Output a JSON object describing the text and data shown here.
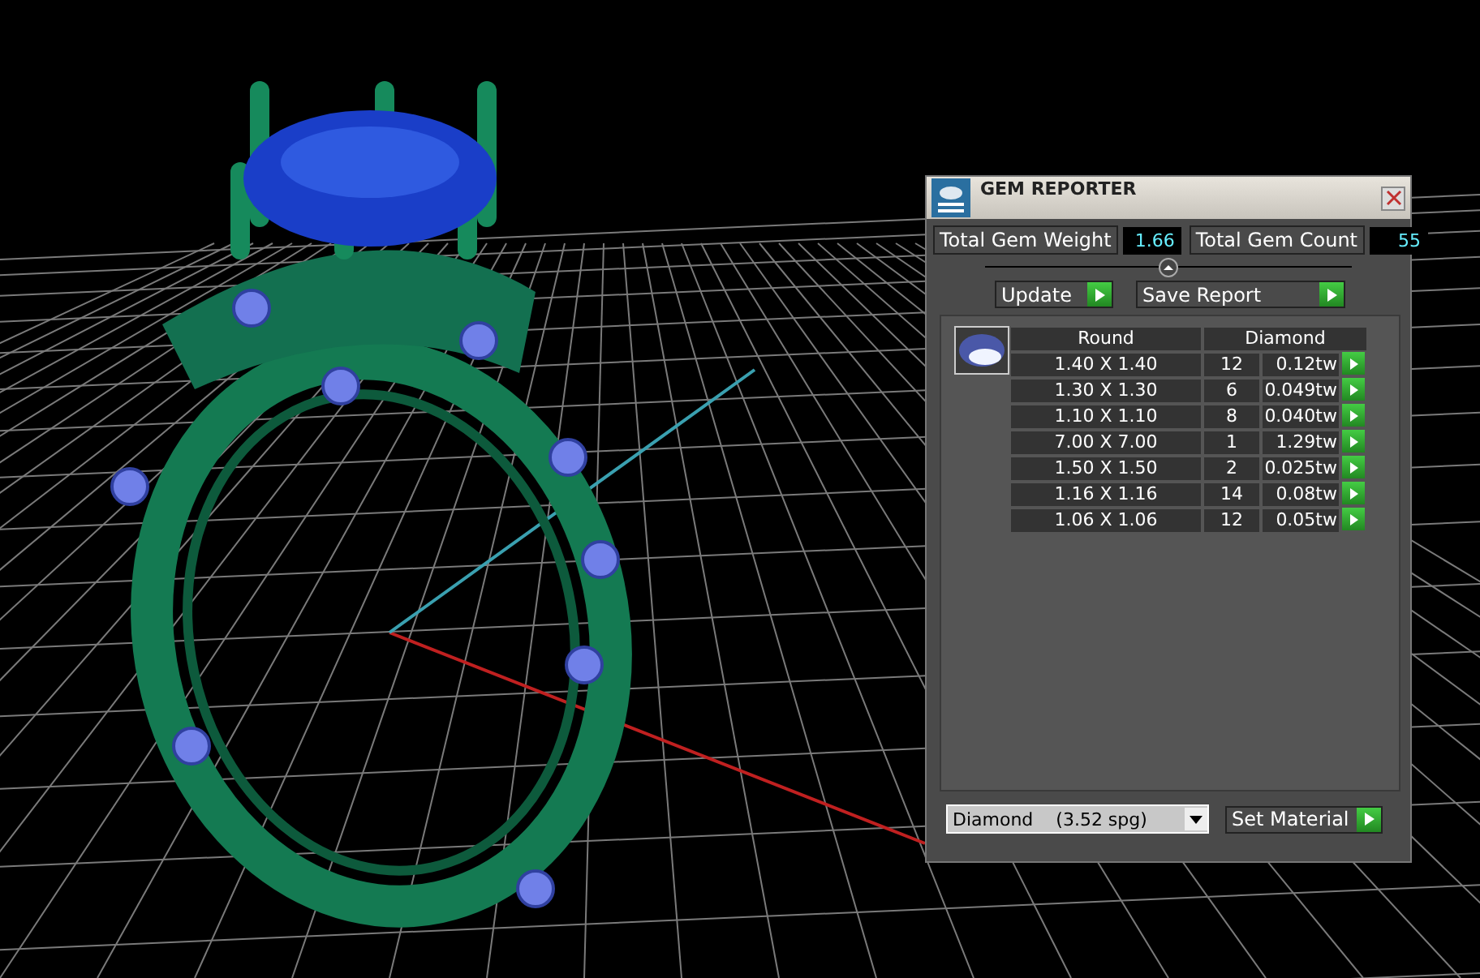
{
  "panel": {
    "title": "GEM REPORTER",
    "total_weight": {
      "label": "Total Gem Weight",
      "value": "1.66"
    },
    "total_count": {
      "label": "Total Gem Count",
      "value": "55"
    },
    "buttons": [
      "Update",
      "Save Report"
    ],
    "table": {
      "columns": [
        "Round",
        "Diamond"
      ],
      "rows": [
        {
          "size": "1.40 X 1.40",
          "count": "12",
          "weight": "0.12tw"
        },
        {
          "size": "1.30 X 1.30",
          "count": "6",
          "weight": "0.049tw"
        },
        {
          "size": "1.10 X 1.10",
          "count": "8",
          "weight": "0.040tw"
        },
        {
          "size": "7.00 X 7.00",
          "count": "1",
          "weight": "1.29tw"
        },
        {
          "size": "1.50 X 1.50",
          "count": "2",
          "weight": "0.025tw"
        },
        {
          "size": "1.16 X 1.16",
          "count": "14",
          "weight": "0.08tw"
        },
        {
          "size": "1.06 X 1.06",
          "count": "12",
          "weight": "0.05tw"
        }
      ]
    },
    "material": {
      "value": "Diamond    (3.52 spg)"
    },
    "set_button": "Set Material"
  }
}
